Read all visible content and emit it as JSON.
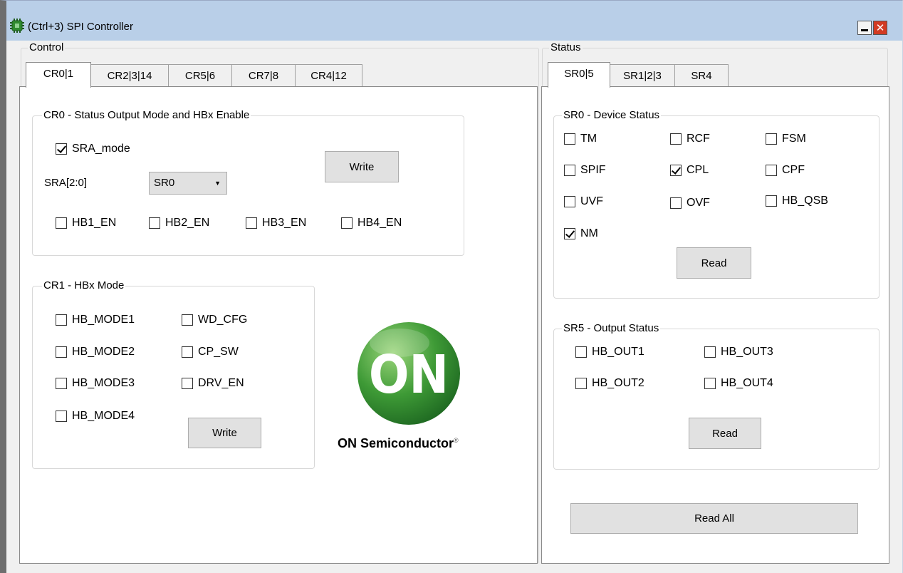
{
  "window": {
    "title": "(Ctrl+3) SPI Controller",
    "close_glyph": "✕"
  },
  "control": {
    "label": "Control",
    "tabs": [
      "CR0|1",
      "CR2|3|14",
      "CR5|6",
      "CR7|8",
      "CR4|12"
    ],
    "cr0": {
      "title": "CR0 - Status Output Mode and HBx Enable",
      "sra_mode": {
        "label": "SRA_mode",
        "checked": true
      },
      "sra_label": "SRA[2:0]",
      "sra_select": {
        "value": "SR0",
        "arrow": "▼"
      },
      "write_label": "Write",
      "hb_en": [
        {
          "label": "HB1_EN",
          "checked": false
        },
        {
          "label": "HB2_EN",
          "checked": false
        },
        {
          "label": "HB3_EN",
          "checked": false
        },
        {
          "label": "HB4_EN",
          "checked": false
        }
      ]
    },
    "cr1": {
      "title": "CR1 - HBx Mode",
      "items": [
        {
          "label": "HB_MODE1",
          "checked": false
        },
        {
          "label": "HB_MODE2",
          "checked": false
        },
        {
          "label": "HB_MODE3",
          "checked": false
        },
        {
          "label": "HB_MODE4",
          "checked": false
        },
        {
          "label": "WD_CFG",
          "checked": false
        },
        {
          "label": "CP_SW",
          "checked": false
        },
        {
          "label": "DRV_EN",
          "checked": false
        }
      ],
      "write_label": "Write"
    },
    "logo": {
      "mark": "ON",
      "text": "ON Semiconductor",
      "reg": "®"
    }
  },
  "status": {
    "label": "Status",
    "tabs": [
      "SR0|5",
      "SR1|2|3",
      "SR4"
    ],
    "sr0": {
      "title": "SR0 - Device Status",
      "items": [
        {
          "label": "TM",
          "checked": false
        },
        {
          "label": "RCF",
          "checked": false
        },
        {
          "label": "FSM",
          "checked": false
        },
        {
          "label": "SPIF",
          "checked": false
        },
        {
          "label": "CPL",
          "checked": true
        },
        {
          "label": "CPF",
          "checked": false
        },
        {
          "label": "UVF",
          "checked": false
        },
        {
          "label": "OVF",
          "checked": false
        },
        {
          "label": "HB_QSB",
          "checked": false
        },
        {
          "label": "NM",
          "checked": true
        }
      ],
      "read_label": "Read"
    },
    "sr5": {
      "title": "SR5 - Output Status",
      "items": [
        {
          "label": "HB_OUT1",
          "checked": false
        },
        {
          "label": "HB_OUT3",
          "checked": false
        },
        {
          "label": "HB_OUT2",
          "checked": false
        },
        {
          "label": "HB_OUT4",
          "checked": false
        }
      ],
      "read_label": "Read"
    },
    "read_all_label": "Read All"
  }
}
